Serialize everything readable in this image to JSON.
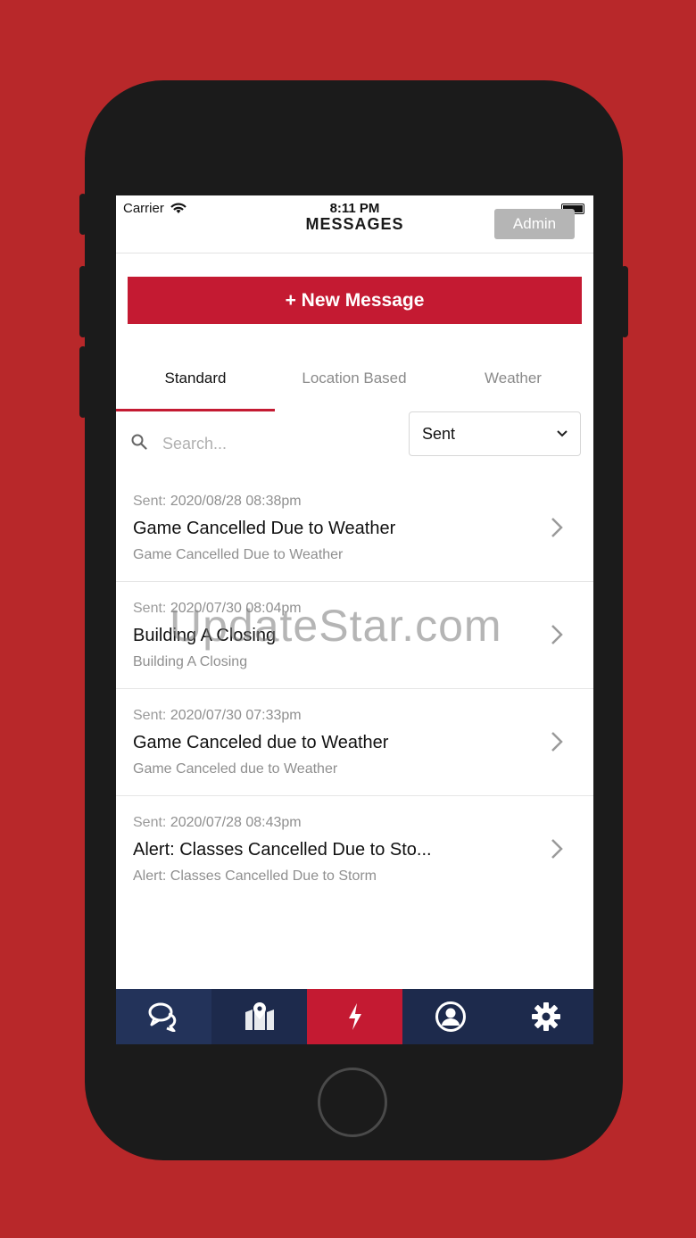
{
  "status": {
    "carrier": "Carrier",
    "time": "8:11 PM"
  },
  "header": {
    "title": "MESSAGES",
    "admin_label": "Admin"
  },
  "actions": {
    "new_message": "+ New Message"
  },
  "tabs": [
    {
      "label": "Standard"
    },
    {
      "label": "Location Based"
    },
    {
      "label": "Weather"
    }
  ],
  "search": {
    "placeholder": "Search..."
  },
  "filter": {
    "selected": "Sent"
  },
  "messages": [
    {
      "meta_label": "Sent:",
      "date": "2020/08/28 08:38pm",
      "title": "Game Cancelled Due to Weather",
      "preview": "Game Cancelled Due to Weather"
    },
    {
      "meta_label": "Sent:",
      "date": "2020/07/30 08:04pm",
      "title": "Building A Closing",
      "preview": "Building A Closing"
    },
    {
      "meta_label": "Sent:",
      "date": "2020/07/30 07:33pm",
      "title": "Game Canceled due to Weather",
      "preview": "Game Canceled due to Weather"
    },
    {
      "meta_label": "Sent:",
      "date": "2020/07/28 08:43pm",
      "title": "Alert: Classes Cancelled Due to Sto...",
      "preview": "Alert: Classes Cancelled Due to Storm"
    }
  ],
  "tabbar": [
    {
      "icon": "chat-bubbles-icon"
    },
    {
      "icon": "map-pin-icon"
    },
    {
      "icon": "lightning-icon"
    },
    {
      "icon": "user-icon"
    },
    {
      "icon": "gear-icon"
    }
  ],
  "colors": {
    "accent": "#c41a32",
    "navy": "#1d2a4c",
    "background": "#b8282a"
  },
  "watermark": "UpdateStar.com"
}
